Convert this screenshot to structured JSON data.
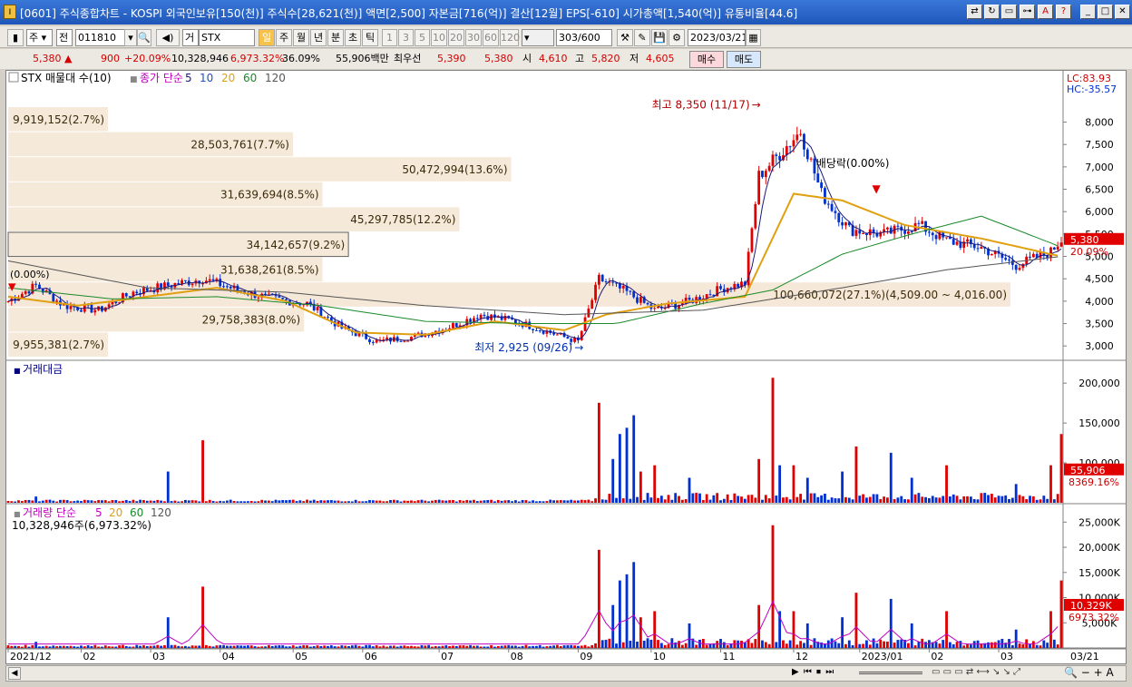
{
  "window": {
    "title": "[0601] 주식종합차트 - KOSPI 외국인보유[150(천)] 주식수[28,621(천)] 액면[2,500] 자본금[716(억)] 결산[12월] EPS[-610] 시가총액[1,540(억)] 유통비율[44.6]"
  },
  "toolbar": {
    "market_select": "주",
    "scope_select": "전",
    "code_value": "011810",
    "name_select": "거",
    "name_value": "STX",
    "period_buttons": [
      "일",
      "주",
      "월",
      "년",
      "분",
      "초",
      "틱"
    ],
    "interval_buttons": [
      "1",
      "3",
      "5",
      "10",
      "20",
      "30",
      "60",
      "120"
    ],
    "count_value": "303",
    "count_max": "/600",
    "date_value": "2023/03/21"
  },
  "quote": {
    "price": "5,380",
    "change": "900",
    "change_pct": "+20.09%",
    "volume": "10,328,946",
    "volume_ratio": "6,973.32%",
    "turnover": "36.09%",
    "amount": "55,906백만",
    "best_ask_label": "최우선",
    "best_ask": "5,390",
    "best_bid": "5,380",
    "open_label": "시",
    "open": "4,610",
    "high_label": "고",
    "high": "5,820",
    "low_label": "저",
    "low": "4,605",
    "buy_button": "매수",
    "sell_button": "매도"
  },
  "chart_data": {
    "type": "candlestick",
    "legend": {
      "main": "STX 매물대 수(10)",
      "ma_label": "종가 단순",
      "ma_periods": [
        "5",
        "10",
        "20",
        "60",
        "120"
      ],
      "lc": "LC:83.93",
      "hc": "HC:-35.57"
    },
    "price_axis": {
      "ticks": [
        "8,000",
        "7,500",
        "7,000",
        "6,500",
        "6,000",
        "5,500",
        "5,000",
        "4,500",
        "4,000",
        "3,500",
        "3,000"
      ],
      "current_price": "5,380",
      "current_change": "20.09%",
      "ylim": [
        2700,
        8700
      ]
    },
    "annotations": {
      "high": "최고 8,350 (11/17)",
      "low": "최저 2,925 (09/26)",
      "ex_dividend": "배당락(0.00%)",
      "start_marker": "(0.00%)"
    },
    "volume_profile": [
      {
        "label": "9,919,152(2.7%)",
        "share": 2.7
      },
      {
        "label": "28,503,761(7.7%)",
        "share": 7.7
      },
      {
        "label": "50,472,994(13.6%)",
        "share": 13.6
      },
      {
        "label": "31,639,694(8.5%)",
        "share": 8.5
      },
      {
        "label": "45,297,785(12.2%)",
        "share": 12.2
      },
      {
        "label": "34,142,657(9.2%)",
        "share": 9.2
      },
      {
        "label": "31,638,261(8.5%)",
        "share": 8.5
      },
      {
        "label": "100,660,072(27.1%)(4,509.00 ~ 4,016.00)",
        "share": 27.1
      },
      {
        "label": "29,758,383(8.0%)",
        "share": 8.0
      },
      {
        "label": "9,955,381(2.7%)",
        "share": 2.7
      }
    ],
    "price_path": [
      [
        0,
        4000
      ],
      [
        8,
        4350
      ],
      [
        16,
        3900
      ],
      [
        26,
        3800
      ],
      [
        36,
        4200
      ],
      [
        46,
        4350
      ],
      [
        56,
        4500
      ],
      [
        66,
        4250
      ],
      [
        76,
        4050
      ],
      [
        86,
        3950
      ],
      [
        96,
        3400
      ],
      [
        106,
        3100
      ],
      [
        116,
        3200
      ],
      [
        126,
        3400
      ],
      [
        136,
        3700
      ],
      [
        146,
        3550
      ],
      [
        156,
        3300
      ],
      [
        164,
        3100
      ],
      [
        170,
        4500
      ],
      [
        178,
        4200
      ],
      [
        186,
        3800
      ],
      [
        196,
        4000
      ],
      [
        206,
        4300
      ],
      [
        212,
        4400
      ],
      [
        216,
        6800
      ],
      [
        222,
        7300
      ],
      [
        228,
        7800
      ],
      [
        234,
        6400
      ],
      [
        242,
        5600
      ],
      [
        252,
        5500
      ],
      [
        262,
        5700
      ],
      [
        270,
        5350
      ],
      [
        280,
        5200
      ],
      [
        290,
        4800
      ],
      [
        300,
        5100
      ],
      [
        303,
        5380
      ]
    ],
    "ma_paths": {
      "ma20": [
        [
          0,
          4100
        ],
        [
          20,
          3900
        ],
        [
          40,
          4100
        ],
        [
          60,
          4300
        ],
        [
          80,
          4000
        ],
        [
          100,
          3300
        ],
        [
          120,
          3250
        ],
        [
          140,
          3550
        ],
        [
          160,
          3350
        ],
        [
          172,
          3700
        ],
        [
          190,
          3950
        ],
        [
          212,
          4100
        ],
        [
          226,
          6400
        ],
        [
          240,
          6250
        ],
        [
          258,
          5700
        ],
        [
          280,
          5400
        ],
        [
          300,
          5050
        ],
        [
          303,
          5000
        ]
      ],
      "ma60": [
        [
          0,
          4300
        ],
        [
          30,
          4050
        ],
        [
          60,
          4100
        ],
        [
          90,
          3900
        ],
        [
          120,
          3550
        ],
        [
          150,
          3500
        ],
        [
          175,
          3500
        ],
        [
          200,
          3950
        ],
        [
          220,
          4250
        ],
        [
          240,
          5050
        ],
        [
          260,
          5500
        ],
        [
          280,
          5900
        ],
        [
          300,
          5300
        ],
        [
          303,
          5200
        ]
      ],
      "ma120": [
        [
          0,
          4900
        ],
        [
          40,
          4300
        ],
        [
          80,
          4200
        ],
        [
          120,
          3900
        ],
        [
          160,
          3700
        ],
        [
          200,
          3800
        ],
        [
          240,
          4300
        ],
        [
          270,
          4700
        ],
        [
          303,
          5000
        ]
      ]
    },
    "trading_value_panel": {
      "title": "거래대금",
      "ticks": [
        "200,000",
        "150,000",
        "100,000"
      ],
      "current": "55,906",
      "current_pct": "8369.16%"
    },
    "volume_panel": {
      "title": "거래량 단순",
      "ma_periods": [
        "5",
        "20",
        "60",
        "120"
      ],
      "info": "10,328,946주(6,973.32%)",
      "ticks": [
        "25,000K",
        "20,000K",
        "15,000K",
        "10,000K",
        "5,000K"
      ],
      "current": "10,329K",
      "current_pct": "6973.32%"
    },
    "volume_spikes": [
      [
        8,
        0.05
      ],
      [
        46,
        0.25
      ],
      [
        56,
        0.5
      ],
      [
        170,
        0.8
      ],
      [
        174,
        0.35
      ],
      [
        176,
        0.55
      ],
      [
        178,
        0.6
      ],
      [
        180,
        0.7
      ],
      [
        182,
        0.25
      ],
      [
        186,
        0.3
      ],
      [
        196,
        0.2
      ],
      [
        216,
        0.35
      ],
      [
        220,
        1.0
      ],
      [
        222,
        0.3
      ],
      [
        226,
        0.3
      ],
      [
        230,
        0.2
      ],
      [
        240,
        0.25
      ],
      [
        244,
        0.45
      ],
      [
        254,
        0.4
      ],
      [
        260,
        0.2
      ],
      [
        270,
        0.3
      ],
      [
        290,
        0.15
      ],
      [
        300,
        0.3
      ],
      [
        303,
        0.55
      ]
    ],
    "x_axis": {
      "labels": [
        "2021/12",
        "02",
        "03",
        "04",
        "05",
        "06",
        "07",
        "08",
        "09",
        "10",
        "11",
        "12",
        "2023/01",
        "02",
        "03"
      ],
      "last_date": "03/21"
    }
  }
}
